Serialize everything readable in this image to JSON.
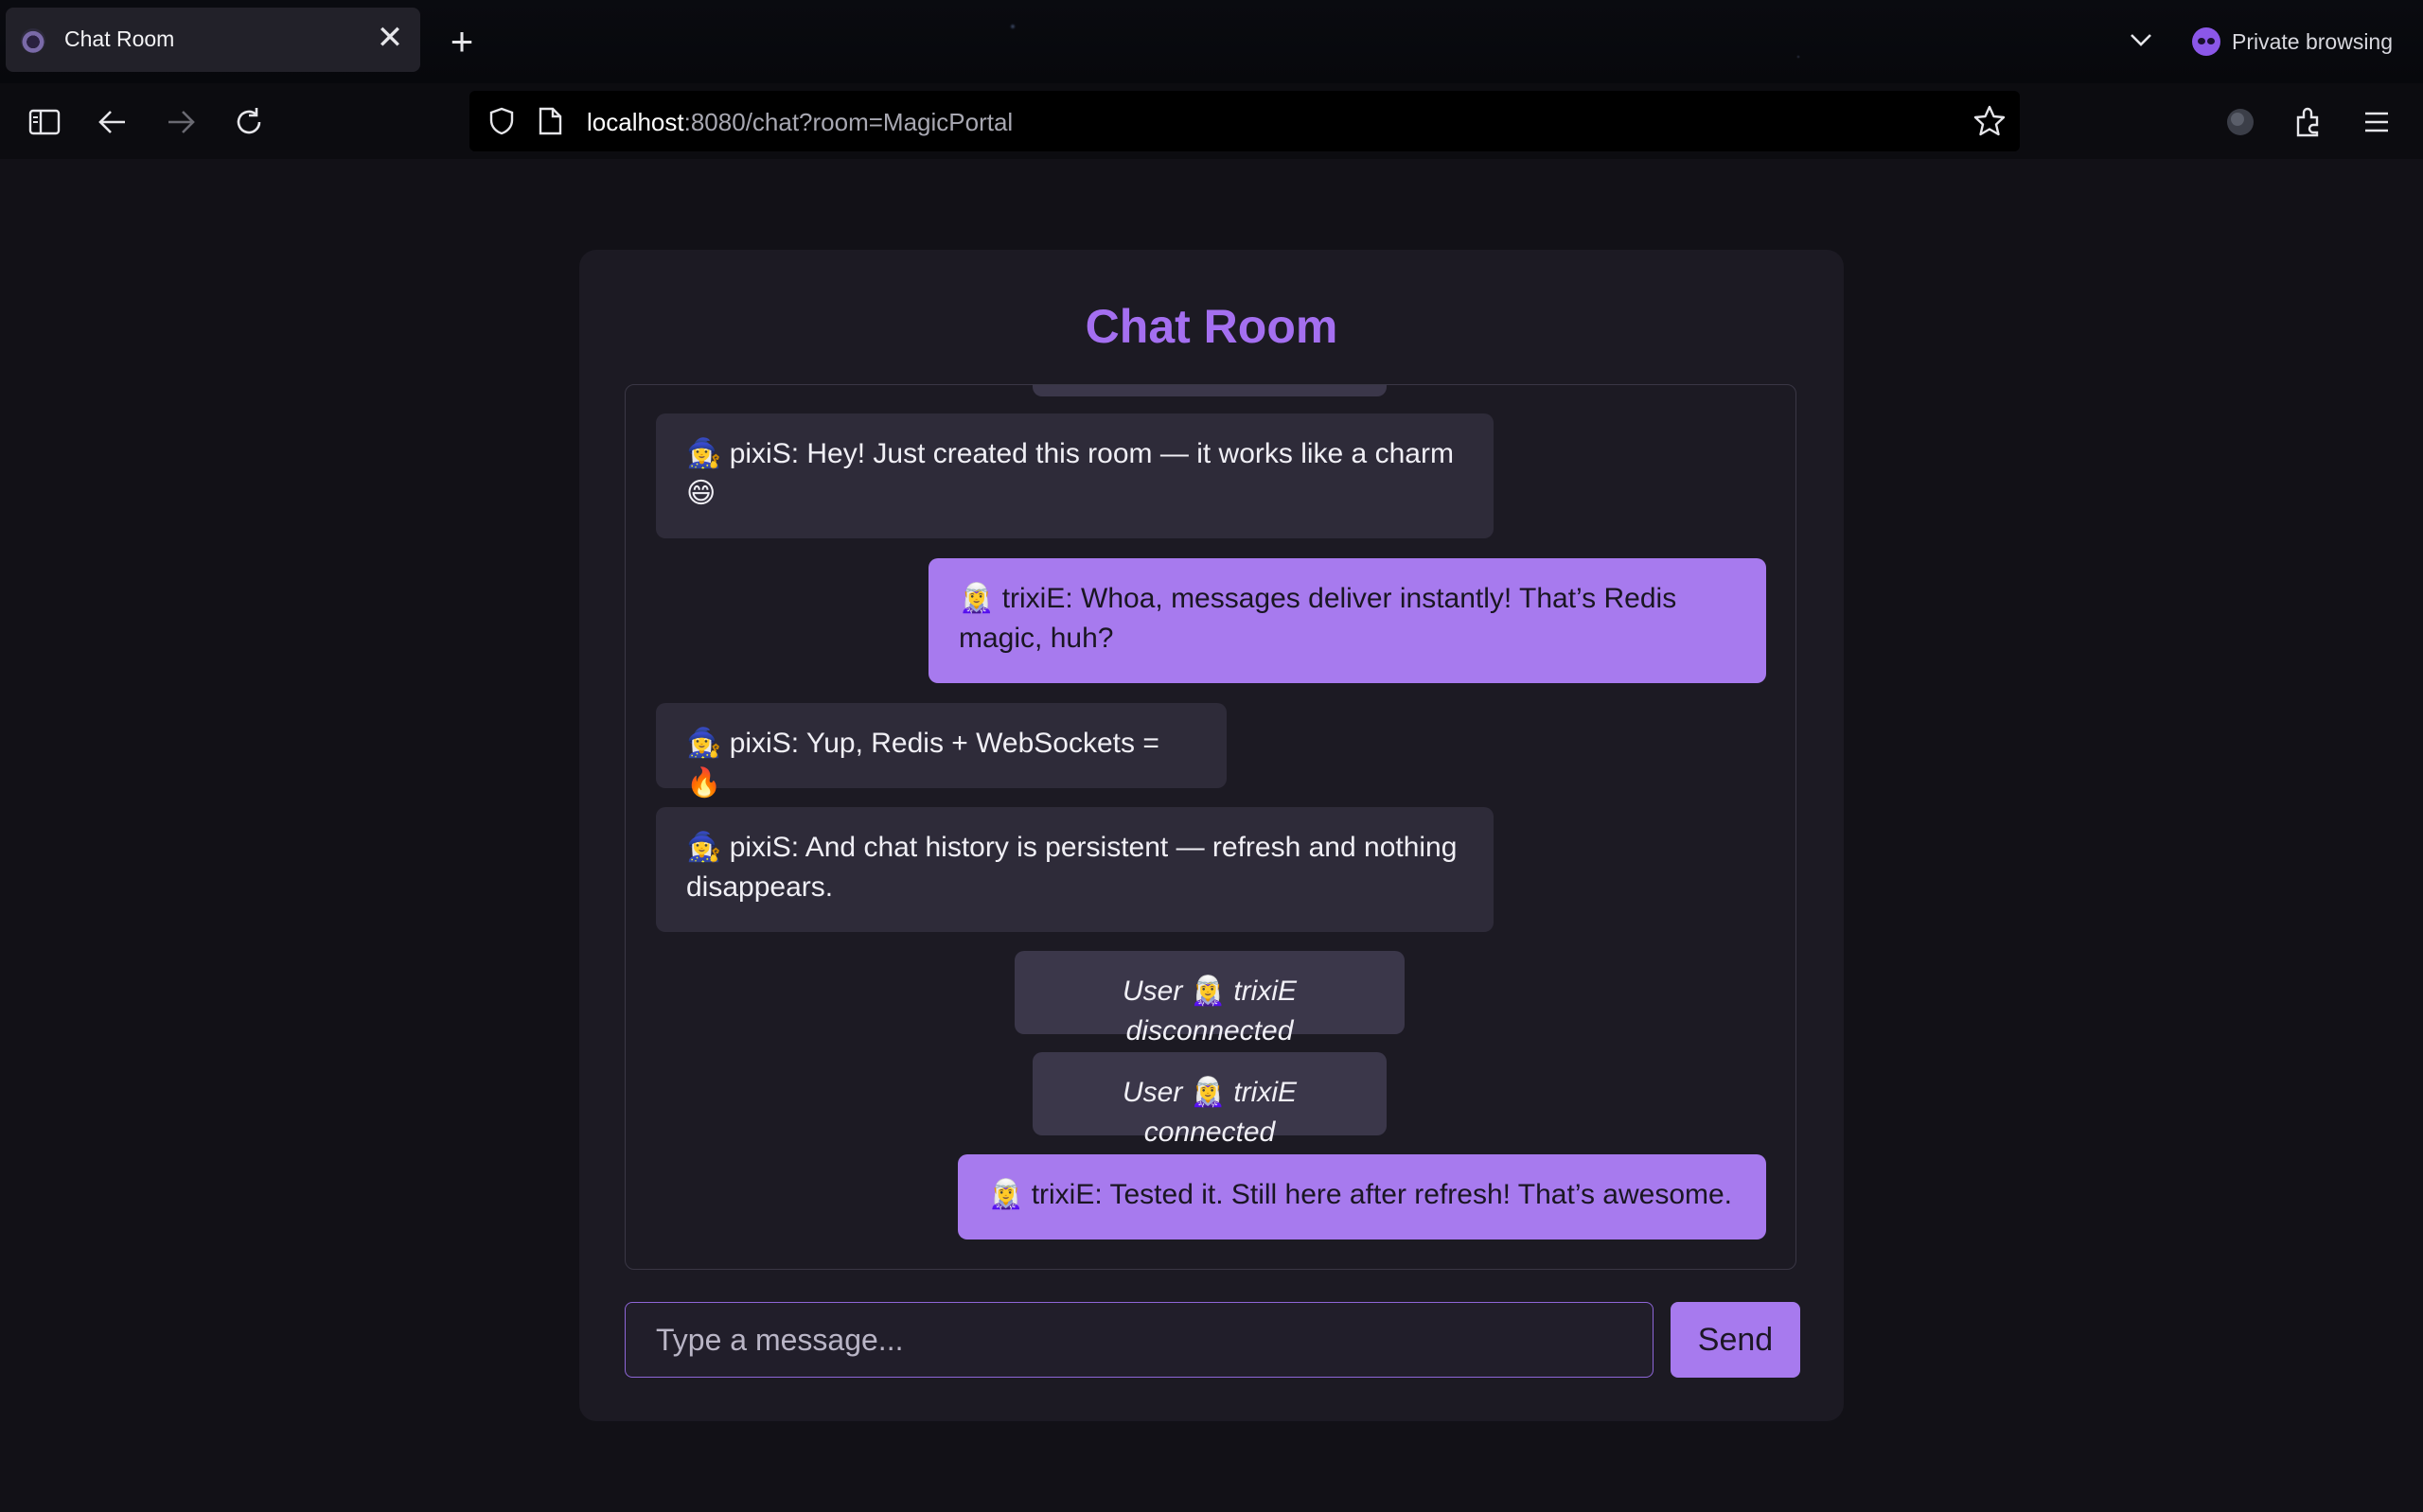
{
  "browser": {
    "tab_title": "Chat Room",
    "tab_close": "✕",
    "new_tab": "+",
    "private_label": "Private browsing",
    "url_host": "localhost",
    "url_rest": ":8080/chat?room=MagicPortal"
  },
  "chat": {
    "title": "Chat Room",
    "messages": [
      {
        "type": "other",
        "emoji": "🧙‍♀️",
        "text": " pixiS: Hey! Just created this room — it works like a charm ",
        "emoji2": "😄"
      },
      {
        "type": "own",
        "emoji": "🧝‍♀️",
        "text": " trixiE: Whoa, messages deliver instantly! That’s Redis magic, huh?"
      },
      {
        "type": "other",
        "emoji": "🧙‍♀️",
        "text": " pixiS: Yup, Redis + WebSockets = ",
        "emoji2": "🔥"
      },
      {
        "type": "other",
        "emoji": "🧙‍♀️",
        "text": " pixiS: And chat history is persistent — refresh and nothing disappears."
      },
      {
        "type": "system",
        "pre": "User ",
        "emoji": "🧝‍♀️",
        "text": " trixiE disconnected"
      },
      {
        "type": "system",
        "pre": "User ",
        "emoji": "🧝‍♀️",
        "text": " trixiE connected"
      },
      {
        "type": "own",
        "emoji": "🧝‍♀️",
        "text": " trixiE: Tested it. Still here after refresh! That’s awesome."
      }
    ],
    "input_placeholder": "Type a message...",
    "input_value": "",
    "send_label": "Send"
  },
  "colors": {
    "accent": "#a77aee",
    "title": "#a46ff0",
    "card_bg": "#1c1a23",
    "other_bubble": "#2e2b39",
    "system_bubble": "#3b374a"
  }
}
